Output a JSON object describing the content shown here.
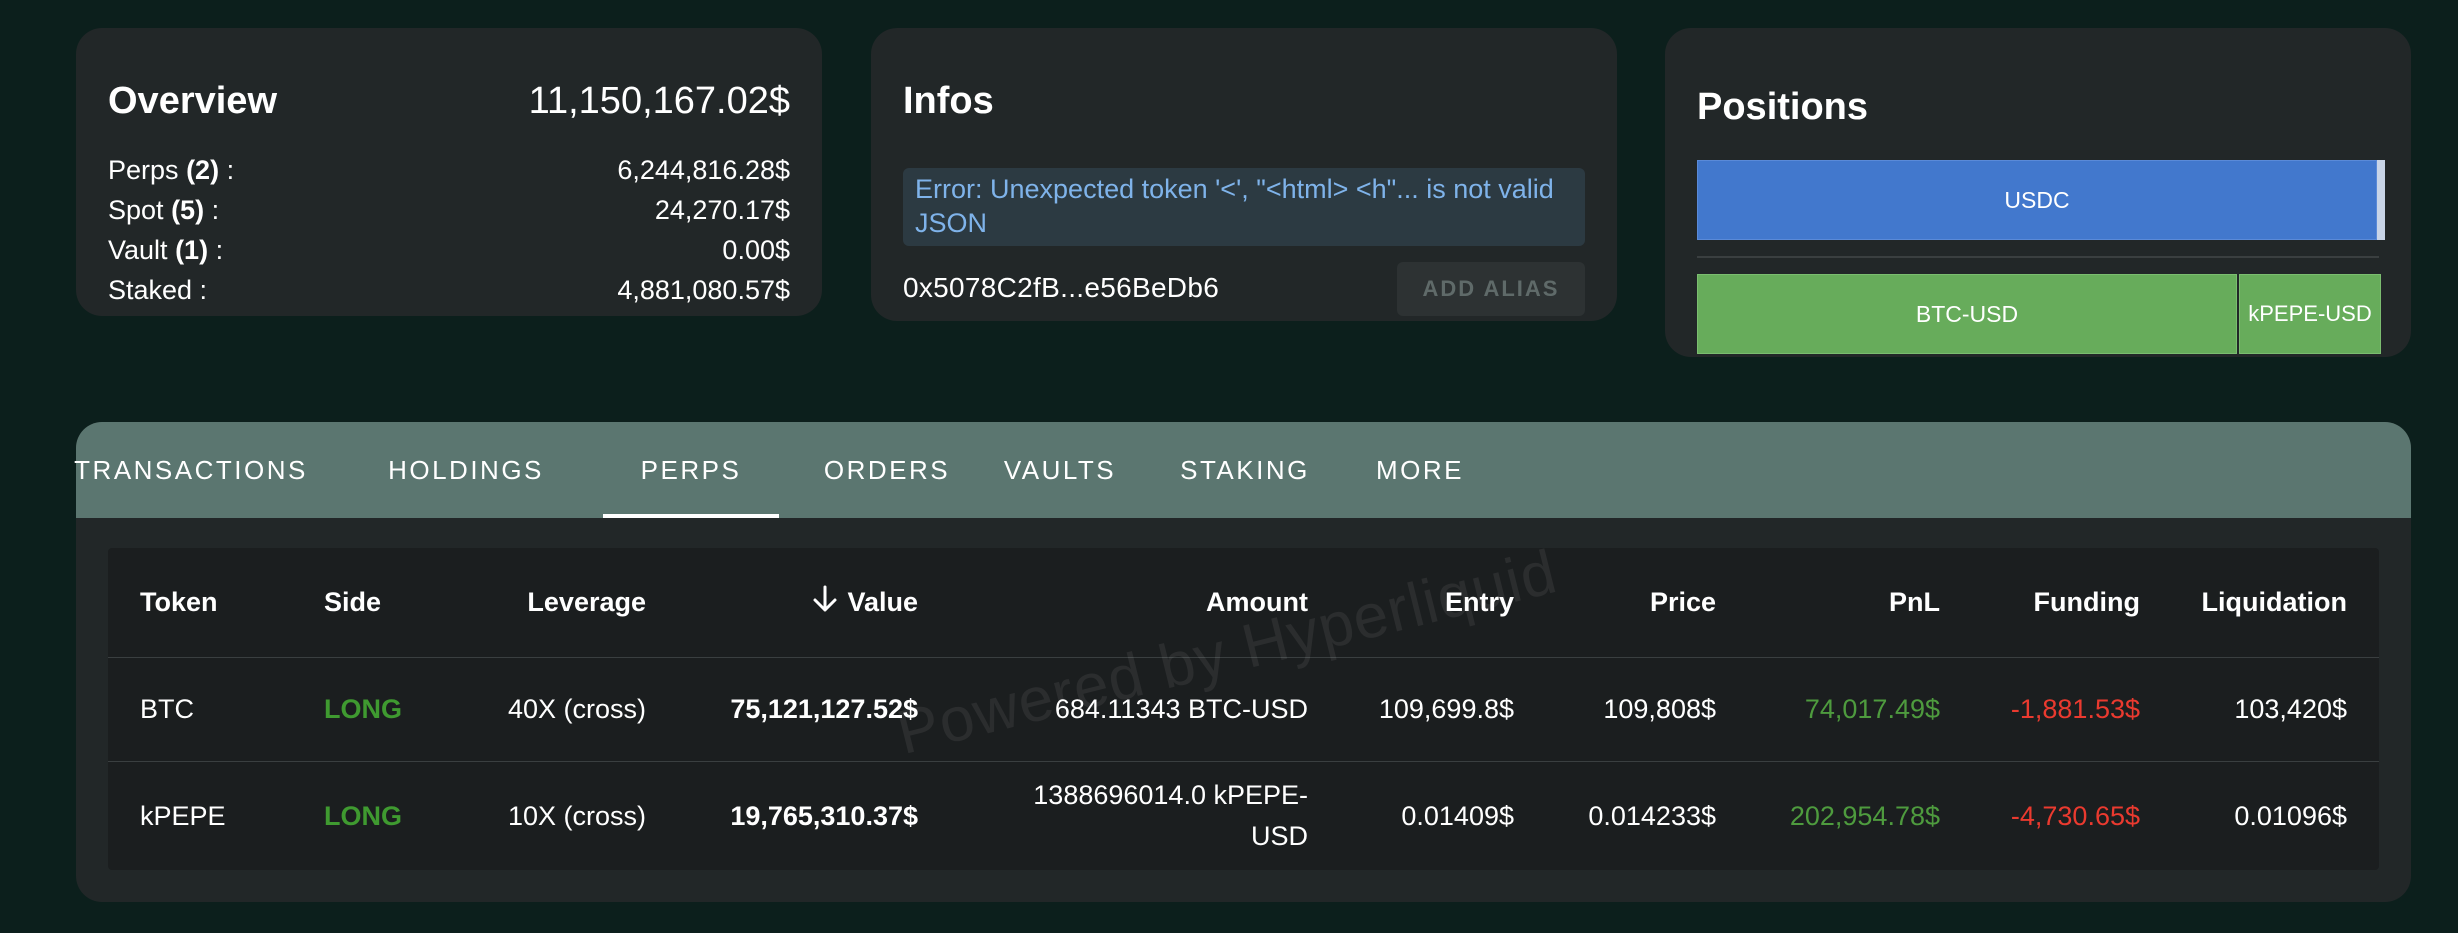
{
  "overview": {
    "title": "Overview",
    "total": "11,150,167.02$",
    "rows": [
      {
        "label": "Perps",
        "count": "(2)",
        "suffix": " :",
        "value": "6,244,816.28$"
      },
      {
        "label": "Spot",
        "count": "(5)",
        "suffix": " :",
        "value": "24,270.17$"
      },
      {
        "label": "Vault",
        "count": "(1)",
        "suffix": " :",
        "value": "0.00$"
      },
      {
        "label": "Staked :",
        "count": "",
        "suffix": "",
        "value": "4,881,080.57$"
      }
    ]
  },
  "infos": {
    "title": "Infos",
    "error": "Error: Unexpected token '<', \"<html> <h\"... is not valid JSON",
    "address": "0x5078C2fB...e56BeDb6",
    "alias_button": "ADD ALIAS"
  },
  "positions": {
    "title": "Positions",
    "bars": {
      "usdc": "USDC",
      "btc": "BTC-USD",
      "kpepe": "kPEPE-USD"
    },
    "colors": {
      "usdc": "#4278cd",
      "perps": "#67ac5b"
    }
  },
  "tabs": [
    {
      "label": "TRANSACTIONS",
      "active": false
    },
    {
      "label": "HOLDINGS",
      "active": false
    },
    {
      "label": "PERPS",
      "active": true
    },
    {
      "label": "ORDERS",
      "active": false
    },
    {
      "label": "VAULTS",
      "active": false
    },
    {
      "label": "STAKING",
      "active": false
    },
    {
      "label": "MORE",
      "active": false
    }
  ],
  "table": {
    "headers": {
      "token": "Token",
      "side": "Side",
      "leverage": "Leverage",
      "value": "Value",
      "amount": "Amount",
      "entry": "Entry",
      "price": "Price",
      "pnl": "PnL",
      "funding": "Funding",
      "liquidation": "Liquidation"
    },
    "sort_icon": "arrow-down-icon",
    "rows": [
      {
        "token": "BTC",
        "side": "LONG",
        "leverage": "40X (cross)",
        "value": "75,121,127.52$",
        "amount_line1": "684.11343 BTC-USD",
        "amount_line2": "",
        "entry": "109,699.8$",
        "price": "109,808$",
        "pnl": "74,017.49$",
        "funding": "-1,881.53$",
        "liquidation": "103,420$"
      },
      {
        "token": "kPEPE",
        "side": "LONG",
        "leverage": "10X (cross)",
        "value": "19,765,310.37$",
        "amount_line1": "1388696014.0 kPEPE-",
        "amount_line2": "USD",
        "entry": "0.01409$",
        "price": "0.014233$",
        "pnl": "202,954.78$",
        "funding": "-4,730.65$",
        "liquidation": "0.01096$"
      }
    ]
  },
  "watermark": "Powered by Hyperliquid"
}
